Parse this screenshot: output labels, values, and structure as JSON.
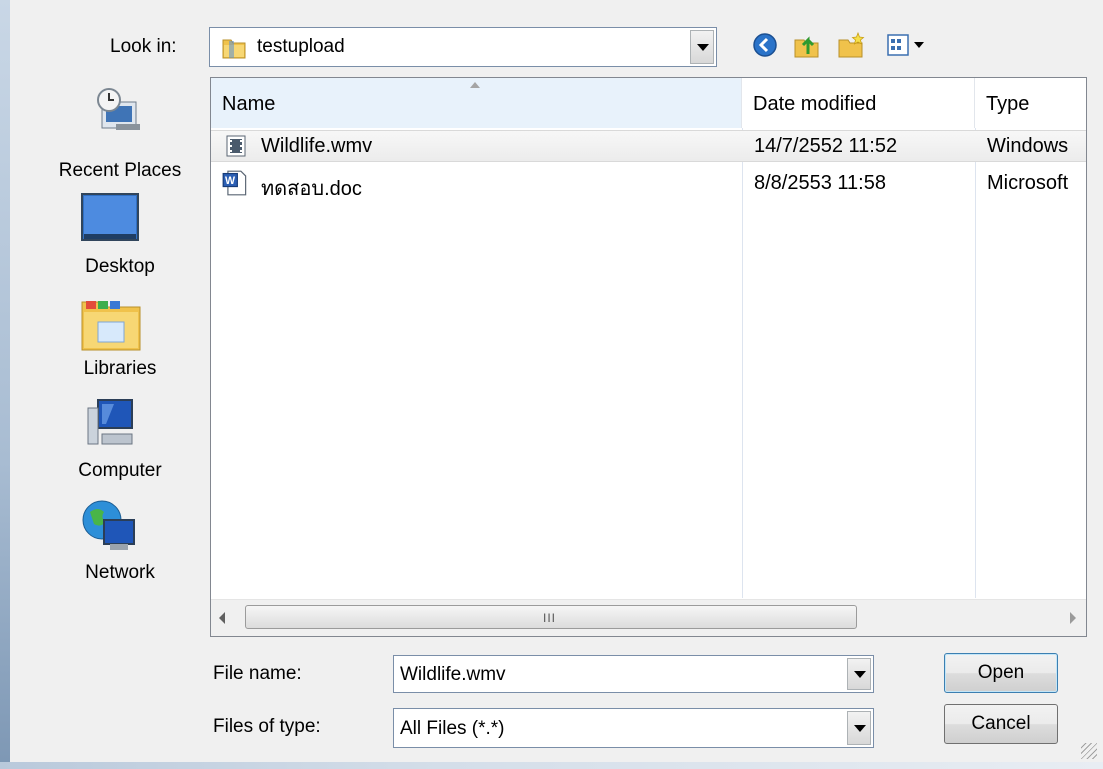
{
  "look_in": {
    "label": "Look in:",
    "value": "testupload"
  },
  "toolbar": {
    "back_icon": "back-arrow-icon",
    "up_icon": "up-folder-icon",
    "new_folder_icon": "new-folder-icon",
    "views_icon": "views-menu-icon"
  },
  "places": [
    {
      "label": "Recent Places",
      "icon": "recent-places-icon"
    },
    {
      "label": "Desktop",
      "icon": "desktop-icon"
    },
    {
      "label": "Libraries",
      "icon": "libraries-icon"
    },
    {
      "label": "Computer",
      "icon": "computer-icon"
    },
    {
      "label": "Network",
      "icon": "network-icon"
    }
  ],
  "columns": {
    "name": "Name",
    "date": "Date modified",
    "type": "Type"
  },
  "files": [
    {
      "name": "Wildlife.wmv",
      "date": "14/7/2552 11:52",
      "type": "Windows",
      "icon": "video-file-icon",
      "selected": true
    },
    {
      "name": "ทดสอบ.doc",
      "date": "8/8/2553 11:58",
      "type": "Microsoft",
      "icon": "word-document-icon",
      "selected": false
    }
  ],
  "scrollbar": {
    "grip": "III"
  },
  "file_name": {
    "label": "File name:",
    "value": "Wildlife.wmv"
  },
  "file_type": {
    "label": "Files of type:",
    "value": "All Files (*.*)"
  },
  "buttons": {
    "open": "Open",
    "cancel": "Cancel"
  },
  "colors": {
    "accent": "#3c7fb1",
    "header_highlight": "#e8f2fb",
    "folder": "#f0c24b"
  }
}
